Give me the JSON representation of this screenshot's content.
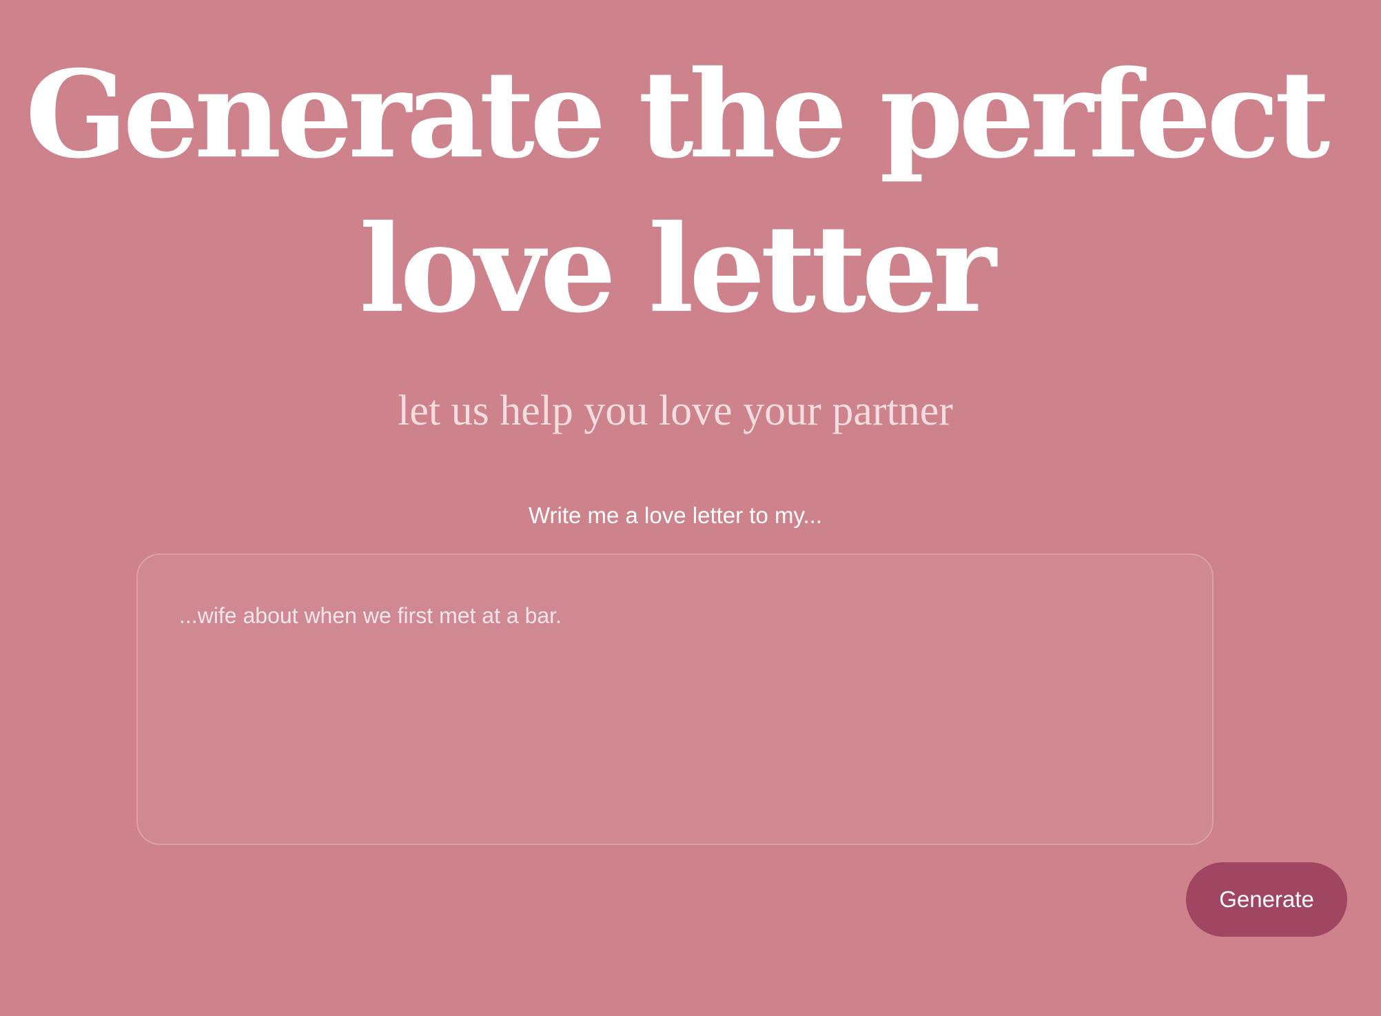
{
  "hero": {
    "title": "Generate the perfect love letter",
    "subtitle": "let us help you love your partner"
  },
  "form": {
    "label": "Write me a love letter to my...",
    "placeholder": "...wife about when we first met at a bar.",
    "value": "",
    "submit_label": "Generate"
  },
  "colors": {
    "background": "#cd828c",
    "button": "#a04663",
    "text": "#ffffff"
  }
}
